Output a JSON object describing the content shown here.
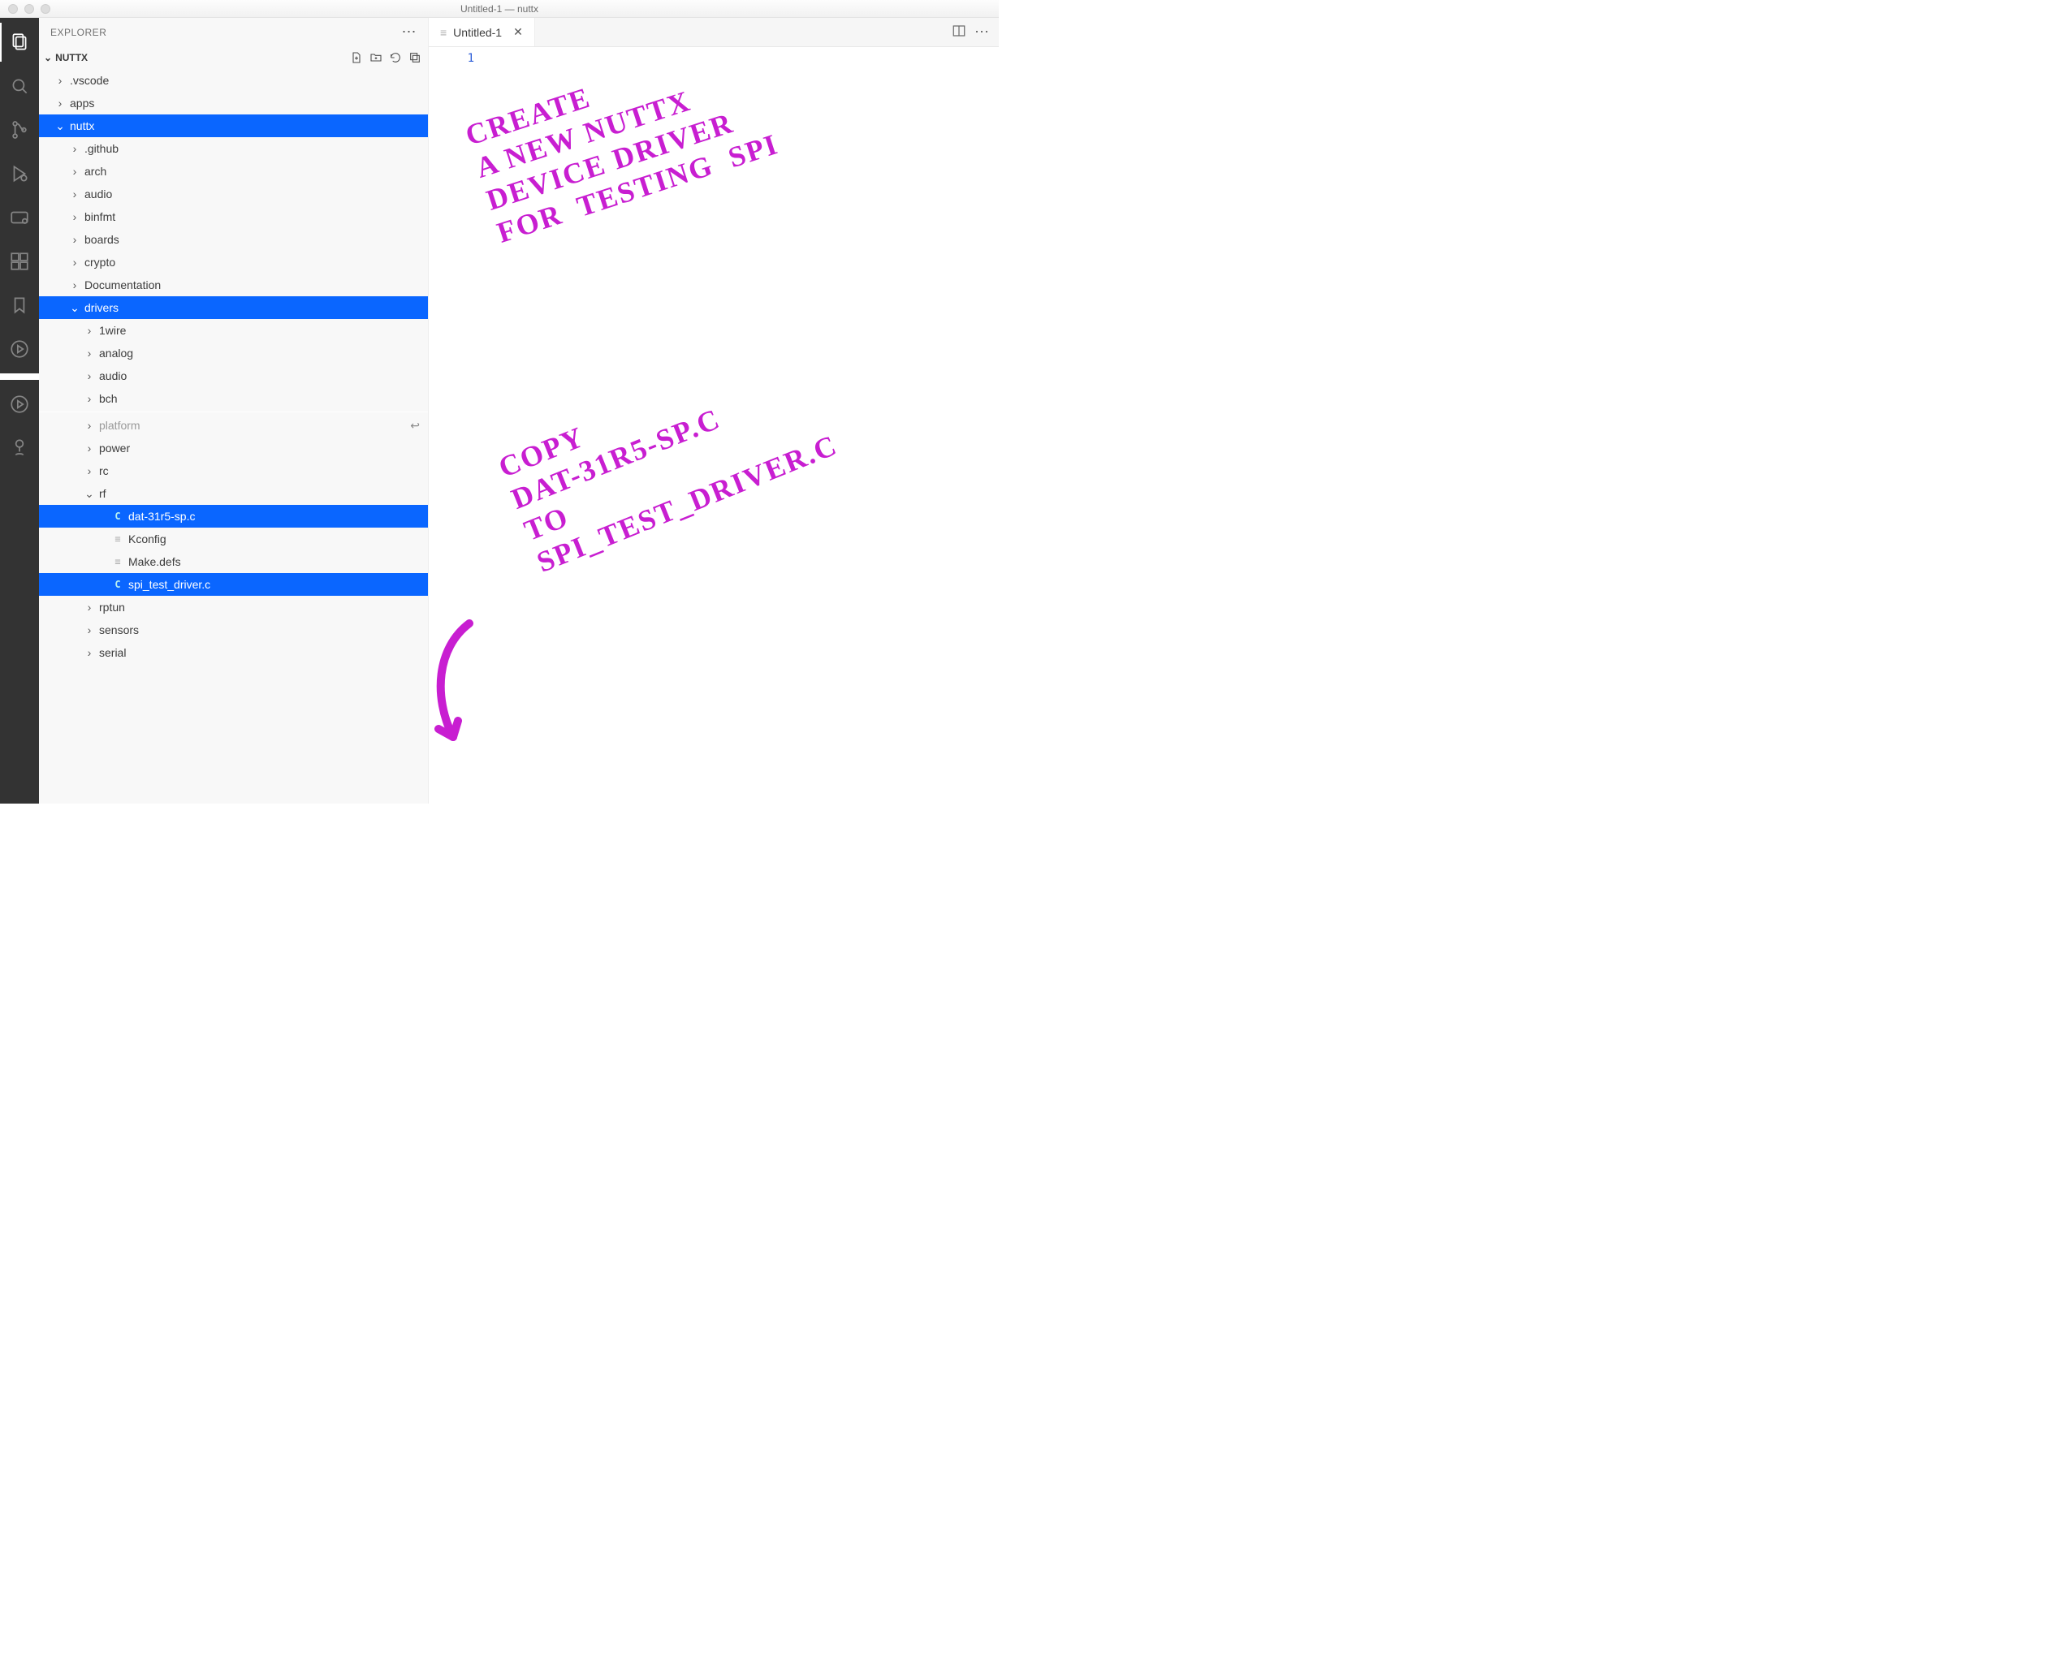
{
  "window": {
    "title": "Untitled-1 — nuttx"
  },
  "sidebar": {
    "title": "EXPLORER",
    "section": "NUTTX",
    "items_top": [
      {
        "label": ".vscode",
        "type": "folder",
        "open": false
      },
      {
        "label": "apps",
        "type": "folder",
        "open": false
      },
      {
        "label": "nuttx",
        "type": "folder",
        "open": true,
        "selected": true
      },
      {
        "label": ".github",
        "type": "folder",
        "open": false,
        "depth": 1
      },
      {
        "label": "arch",
        "type": "folder",
        "open": false,
        "depth": 1
      },
      {
        "label": "audio",
        "type": "folder",
        "open": false,
        "depth": 1
      },
      {
        "label": "binfmt",
        "type": "folder",
        "open": false,
        "depth": 1
      },
      {
        "label": "boards",
        "type": "folder",
        "open": false,
        "depth": 1
      },
      {
        "label": "crypto",
        "type": "folder",
        "open": false,
        "depth": 1
      },
      {
        "label": "Documentation",
        "type": "folder",
        "open": false,
        "depth": 1
      },
      {
        "label": "drivers",
        "type": "folder",
        "open": true,
        "depth": 1,
        "selected": true
      },
      {
        "label": "1wire",
        "type": "folder",
        "open": false,
        "depth": 2
      },
      {
        "label": "analog",
        "type": "folder",
        "open": false,
        "depth": 2
      },
      {
        "label": "audio",
        "type": "folder",
        "open": false,
        "depth": 2
      },
      {
        "label": "bch",
        "type": "folder",
        "open": false,
        "depth": 2
      }
    ],
    "items_bottom": [
      {
        "label": "platform",
        "type": "folder",
        "open": false,
        "depth": 2,
        "dim": true,
        "reply": true
      },
      {
        "label": "power",
        "type": "folder",
        "open": false,
        "depth": 2
      },
      {
        "label": "rc",
        "type": "folder",
        "open": false,
        "depth": 2
      },
      {
        "label": "rf",
        "type": "folder",
        "open": true,
        "depth": 2
      },
      {
        "label": "dat-31r5-sp.c",
        "type": "file",
        "lang": "c",
        "depth": 3,
        "selected": true
      },
      {
        "label": "Kconfig",
        "type": "file",
        "lang": "text",
        "depth": 3
      },
      {
        "label": "Make.defs",
        "type": "file",
        "lang": "text",
        "depth": 3
      },
      {
        "label": "spi_test_driver.c",
        "type": "file",
        "lang": "c",
        "depth": 3,
        "selected": true
      },
      {
        "label": "rptun",
        "type": "folder",
        "open": false,
        "depth": 2
      },
      {
        "label": "sensors",
        "type": "folder",
        "open": false,
        "depth": 2
      },
      {
        "label": "serial",
        "type": "folder",
        "open": false,
        "depth": 2
      }
    ]
  },
  "tabs": [
    {
      "label": "Untitled-1",
      "active": true
    }
  ],
  "editor": {
    "line_numbers": [
      "1"
    ]
  },
  "annotations": {
    "note1": "CREATE\nA NEW NUTTX\nDEVICE DRIVER\nFOR  TESTING  SPI",
    "note2": "COPY\nDAT-31R5-SP.C\nTO\nSPI_TEST_DRIVER.C"
  },
  "icons": {
    "explorer": "explorer-icon",
    "search": "search-icon",
    "scm": "source-control-icon",
    "debug": "run-debug-icon",
    "remote": "remote-icon",
    "extensions": "extensions-icon",
    "bookmark": "bookmark-icon",
    "play": "play-circle-icon",
    "tree": "tree-icon"
  }
}
